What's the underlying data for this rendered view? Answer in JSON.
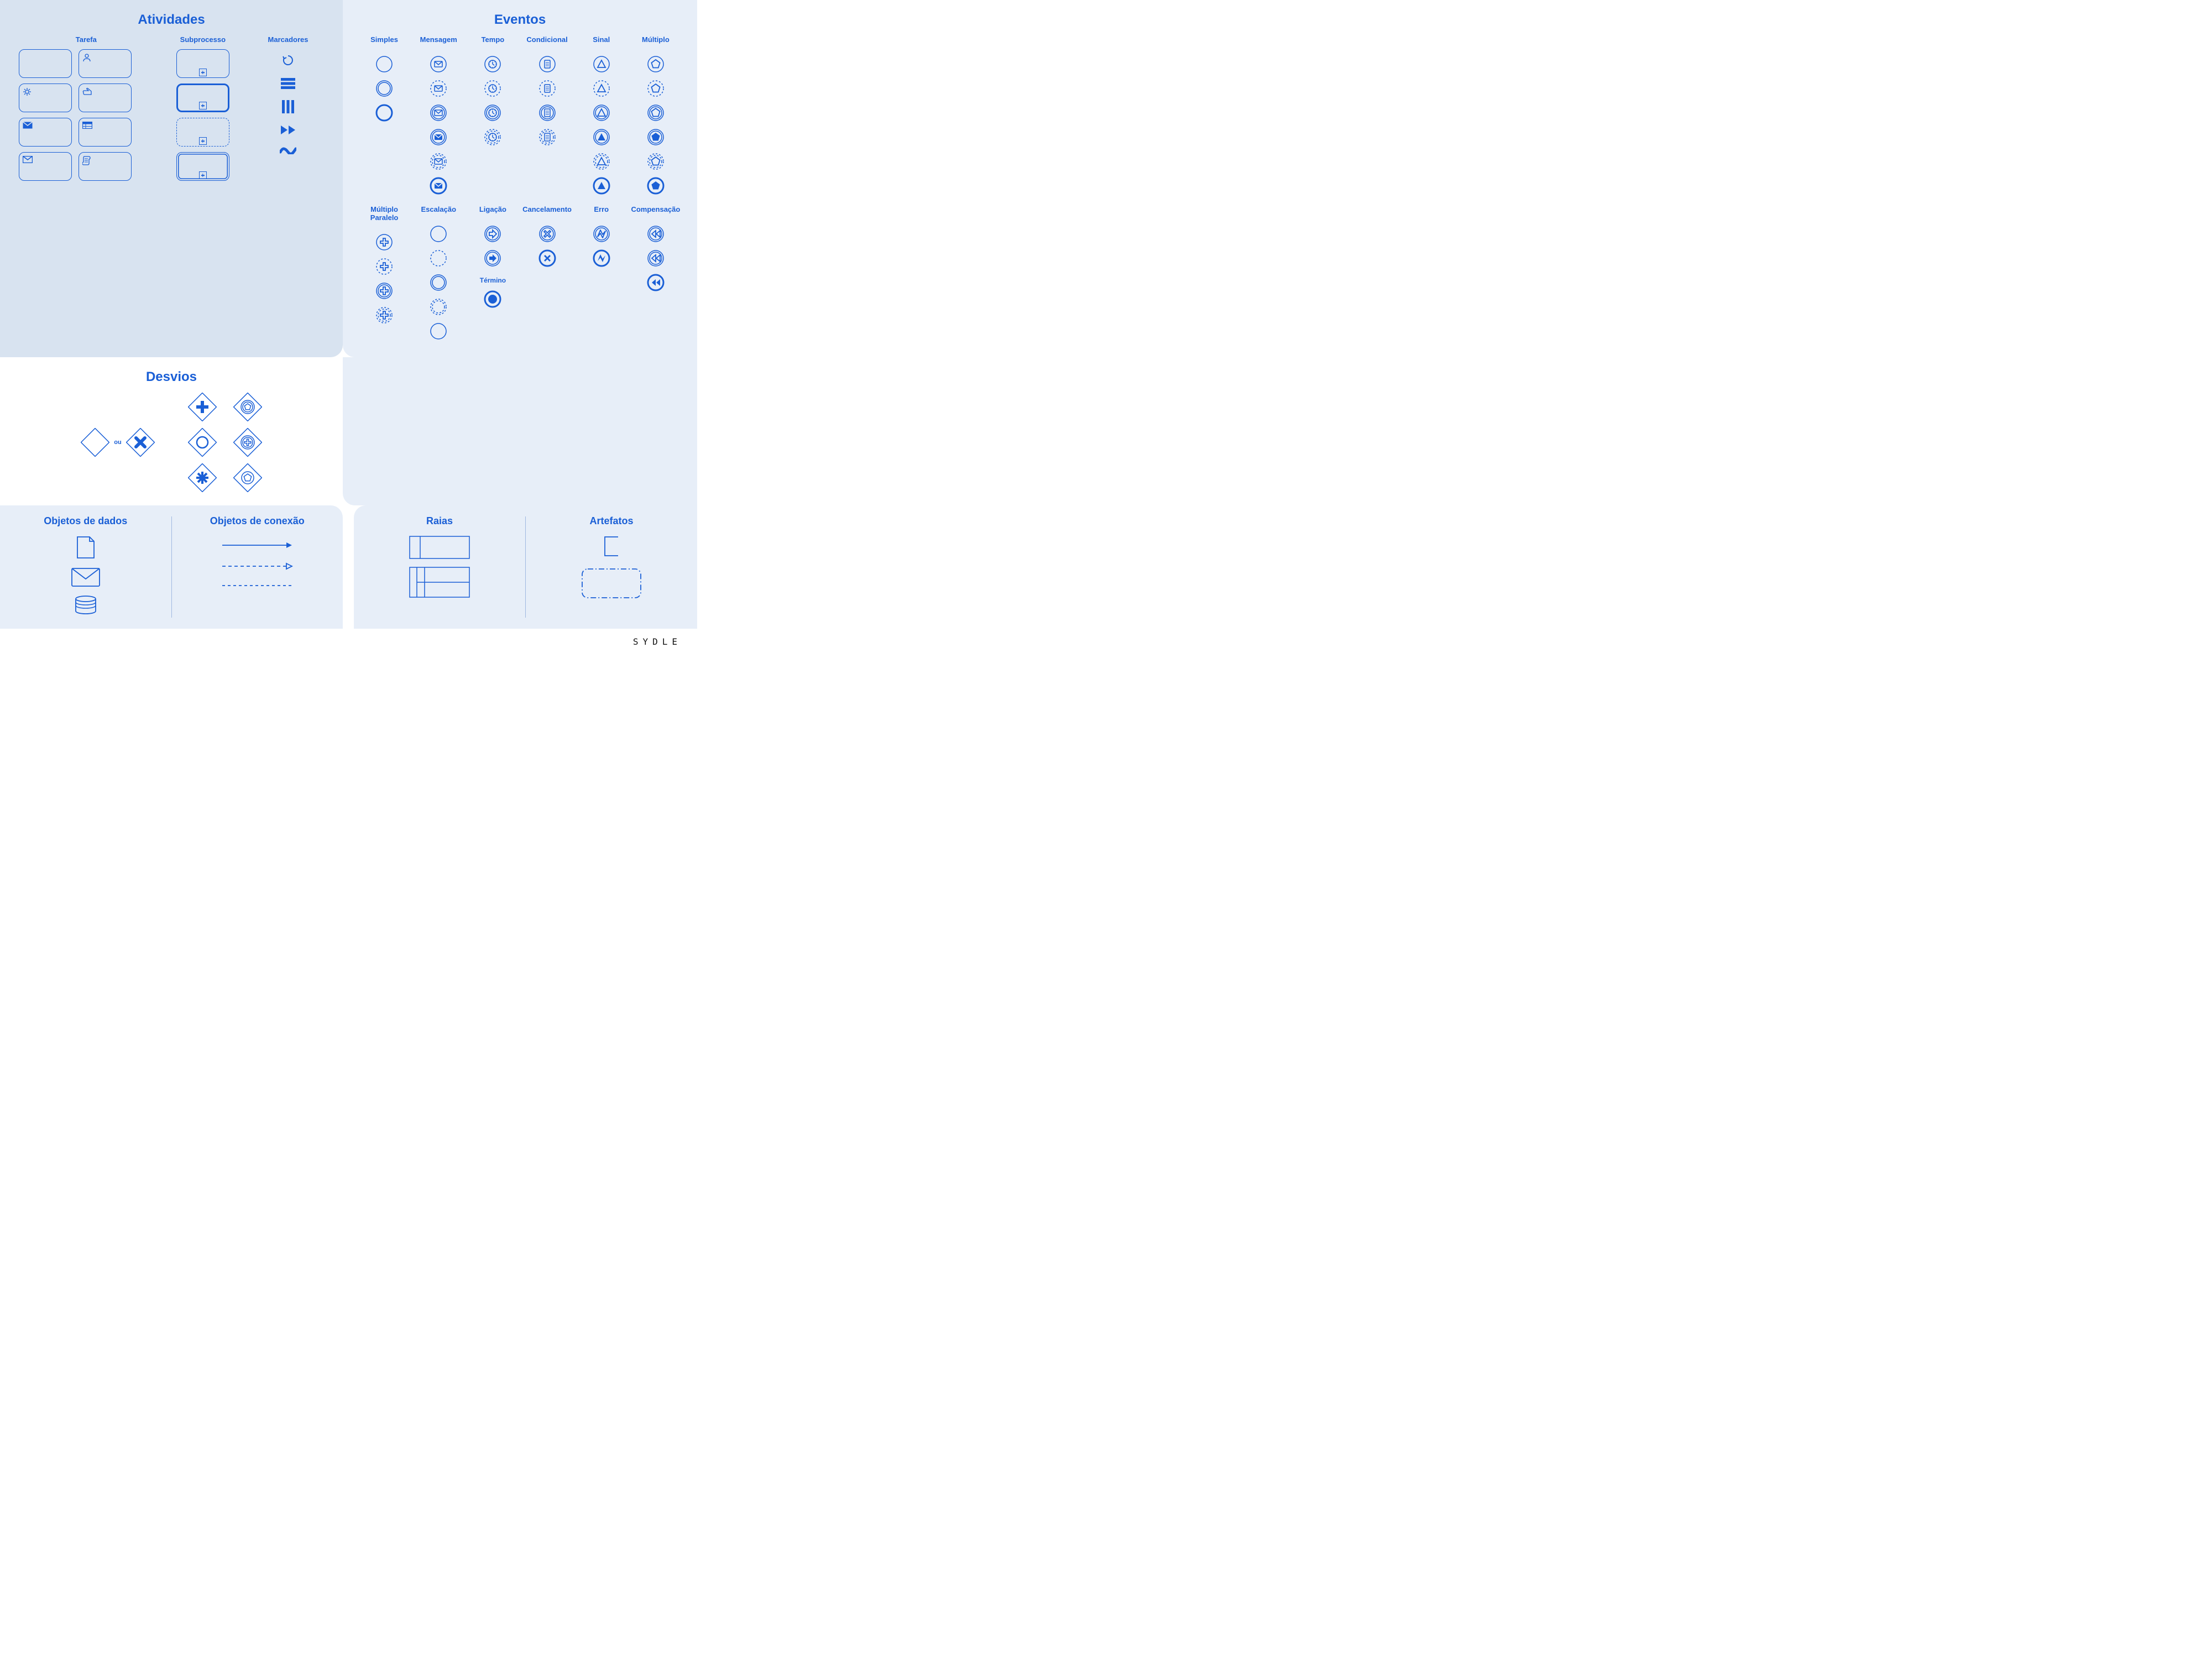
{
  "brand": "SYDLE",
  "atividades": {
    "title": "Atividades",
    "tarefa": {
      "title": "Tarefa",
      "items": [
        "none",
        "user",
        "gear",
        "hand",
        "mail-fill",
        "card",
        "mail-outline",
        "script"
      ]
    },
    "subprocesso": {
      "title": "Subprocesso",
      "items": [
        "normal",
        "thick",
        "dashed",
        "double"
      ]
    },
    "marcadores": {
      "title": "Marcadores",
      "items": [
        "loop",
        "sequential",
        "parallel",
        "compensation",
        "adhoc"
      ]
    }
  },
  "desvios": {
    "title": "Desvios",
    "ou": "ou"
  },
  "eventos": {
    "title": "Eventos",
    "row1": {
      "simples": "Simples",
      "mensagem": "Mensagem",
      "tempo": "Tempo",
      "condicional": "Condicional",
      "sinal": "Sinal",
      "multiplo": "Múltiplo"
    },
    "row2": {
      "multiplo_paralelo": "Múltiplo\nParalelo",
      "escalacao": "Escalação",
      "ligacao": "Ligação",
      "cancelamento": "Cancelamento",
      "erro": "Erro",
      "compensacao": "Compensação"
    },
    "termino": "Término"
  },
  "objetos_dados": {
    "title": "Objetos de dados"
  },
  "objetos_conexao": {
    "title": "Objetos de conexão"
  },
  "raias": {
    "title": "Raias"
  },
  "artefatos": {
    "title": "Artefatos"
  }
}
